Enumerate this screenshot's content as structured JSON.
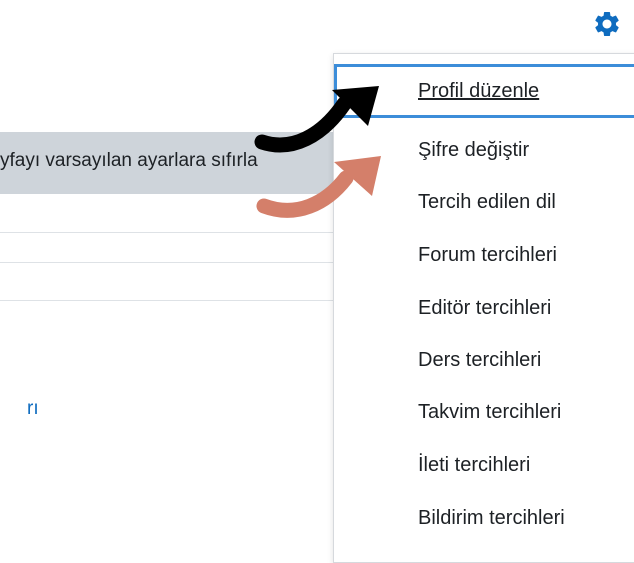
{
  "background": {
    "reset_label": "yfayı varsayılan ayarlara sıfırla",
    "link_fragment": "rı"
  },
  "gear": {
    "icon": "gear-icon",
    "color": "#0f6cbf"
  },
  "menu": {
    "items": [
      {
        "label": "Profil düzenle",
        "active": true
      },
      {
        "label": "Şifre değiştir"
      },
      {
        "label": "Tercih edilen dil"
      },
      {
        "label": "Forum tercihleri"
      },
      {
        "label": "Editör tercihleri"
      },
      {
        "label": "Ders tercihleri"
      },
      {
        "label": "Takvim tercihleri"
      },
      {
        "label": "İleti tercihleri"
      },
      {
        "label": "Bildirim tercihleri"
      }
    ],
    "active_border_color": "#3c8dd9"
  },
  "annotations": {
    "arrow_primary_color": "#000000",
    "arrow_secondary_color": "#d47f6a"
  }
}
